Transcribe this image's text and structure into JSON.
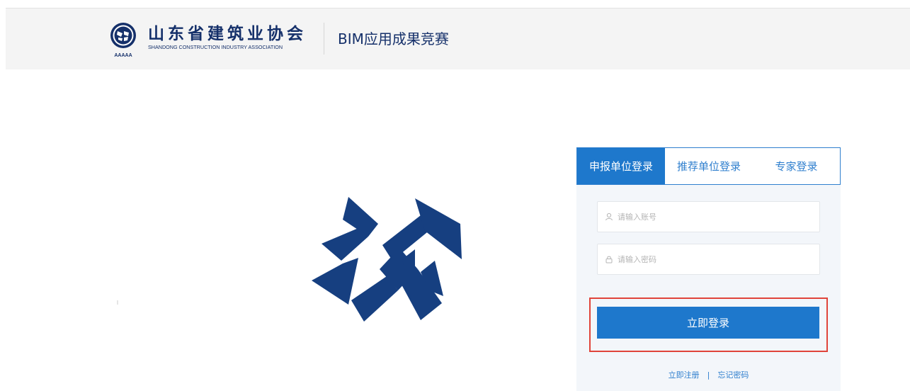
{
  "header": {
    "org_name_cn": "山东省建筑业协会",
    "org_name_en": "SHANDONG CONSTRUCTION INDUSTRY ASSOCIATION",
    "seal_caption": "AAAAA",
    "event_title": "BIM应用成果竞赛"
  },
  "login": {
    "tabs": [
      {
        "label": "申报单位登录",
        "active": true
      },
      {
        "label": "推荐单位登录",
        "active": false
      },
      {
        "label": "专家登录",
        "active": false
      }
    ],
    "account": {
      "placeholder": "请输入账号",
      "value": ""
    },
    "password": {
      "placeholder": "请输入密码",
      "value": ""
    },
    "submit_label": "立即登录",
    "register_link": "立即注册",
    "separator": "|",
    "forgot_link": "忘记密码"
  },
  "colors": {
    "brand_navy": "#15306a",
    "primary_blue": "#1e78cc",
    "highlight_red": "#e0443a",
    "header_bg": "#f4f4f4",
    "panel_bg": "#f3f6fa"
  },
  "icons": {
    "account": "user-icon",
    "password": "lock-icon",
    "seal": "association-seal-icon",
    "emblem": "association-emblem-logo"
  }
}
